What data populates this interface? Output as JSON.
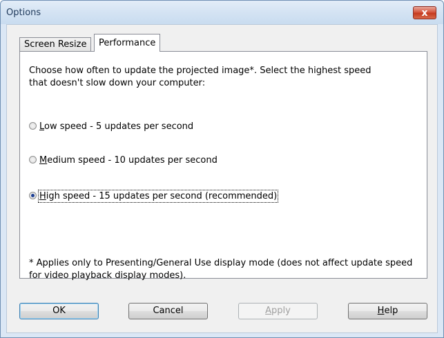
{
  "window": {
    "title": "Options",
    "close_glyph": "x"
  },
  "tabs": [
    {
      "label": "Screen Resize",
      "active": false
    },
    {
      "label": "Performance",
      "active": true
    }
  ],
  "panel": {
    "description": "Choose how often to update the projected image*. Select the highest speed that doesn't slow down your computer:",
    "options": [
      {
        "accel": "L",
        "label_rest": "ow speed - 5 updates per second",
        "checked": false
      },
      {
        "accel": "M",
        "label_rest": "edium speed - 10 updates per second",
        "checked": false
      },
      {
        "accel": "H",
        "label_rest": "igh speed - 15 updates per second (recommended)",
        "checked": true
      }
    ],
    "note": "* Applies only to Presenting/General Use display mode (does not affect update speed for video playback display modes)."
  },
  "buttons": {
    "ok": "OK",
    "cancel": "Cancel",
    "apply_accel": "A",
    "apply_rest": "pply",
    "help_accel": "H",
    "help_rest": "elp"
  },
  "colors": {
    "titlebar": "#d4e3f3",
    "close_button": "#c43a1f",
    "panel_bg": "#ffffff",
    "client_bg": "#f0f0f0"
  },
  "icons": {
    "close": "close-icon"
  }
}
